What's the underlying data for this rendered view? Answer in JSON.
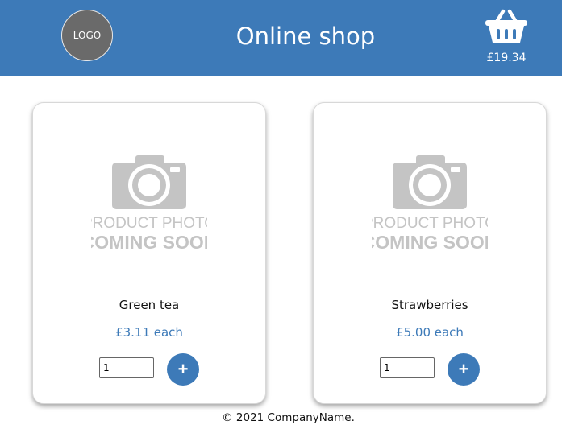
{
  "header": {
    "logo_text": "LOGO",
    "title": "Online shop",
    "cart_icon": "basket-icon",
    "cart_total": "£19.34"
  },
  "products": [
    {
      "photo_line1": "PRODUCT PHOTO",
      "photo_line2": "COMING SOON",
      "name": "Green tea",
      "price": "£3.11 each",
      "quantity": "1",
      "add_label": "+"
    },
    {
      "photo_line1": "PRODUCT PHOTO",
      "photo_line2": "COMING SOON",
      "name": "Strawberries",
      "price": "£5.00 each",
      "quantity": "1",
      "add_label": "+"
    }
  ],
  "footer": {
    "copyright": "© 2021 CompanyName."
  },
  "colors": {
    "brand": "#3d7ab8",
    "placeholder_gray": "#c4c4c4"
  }
}
